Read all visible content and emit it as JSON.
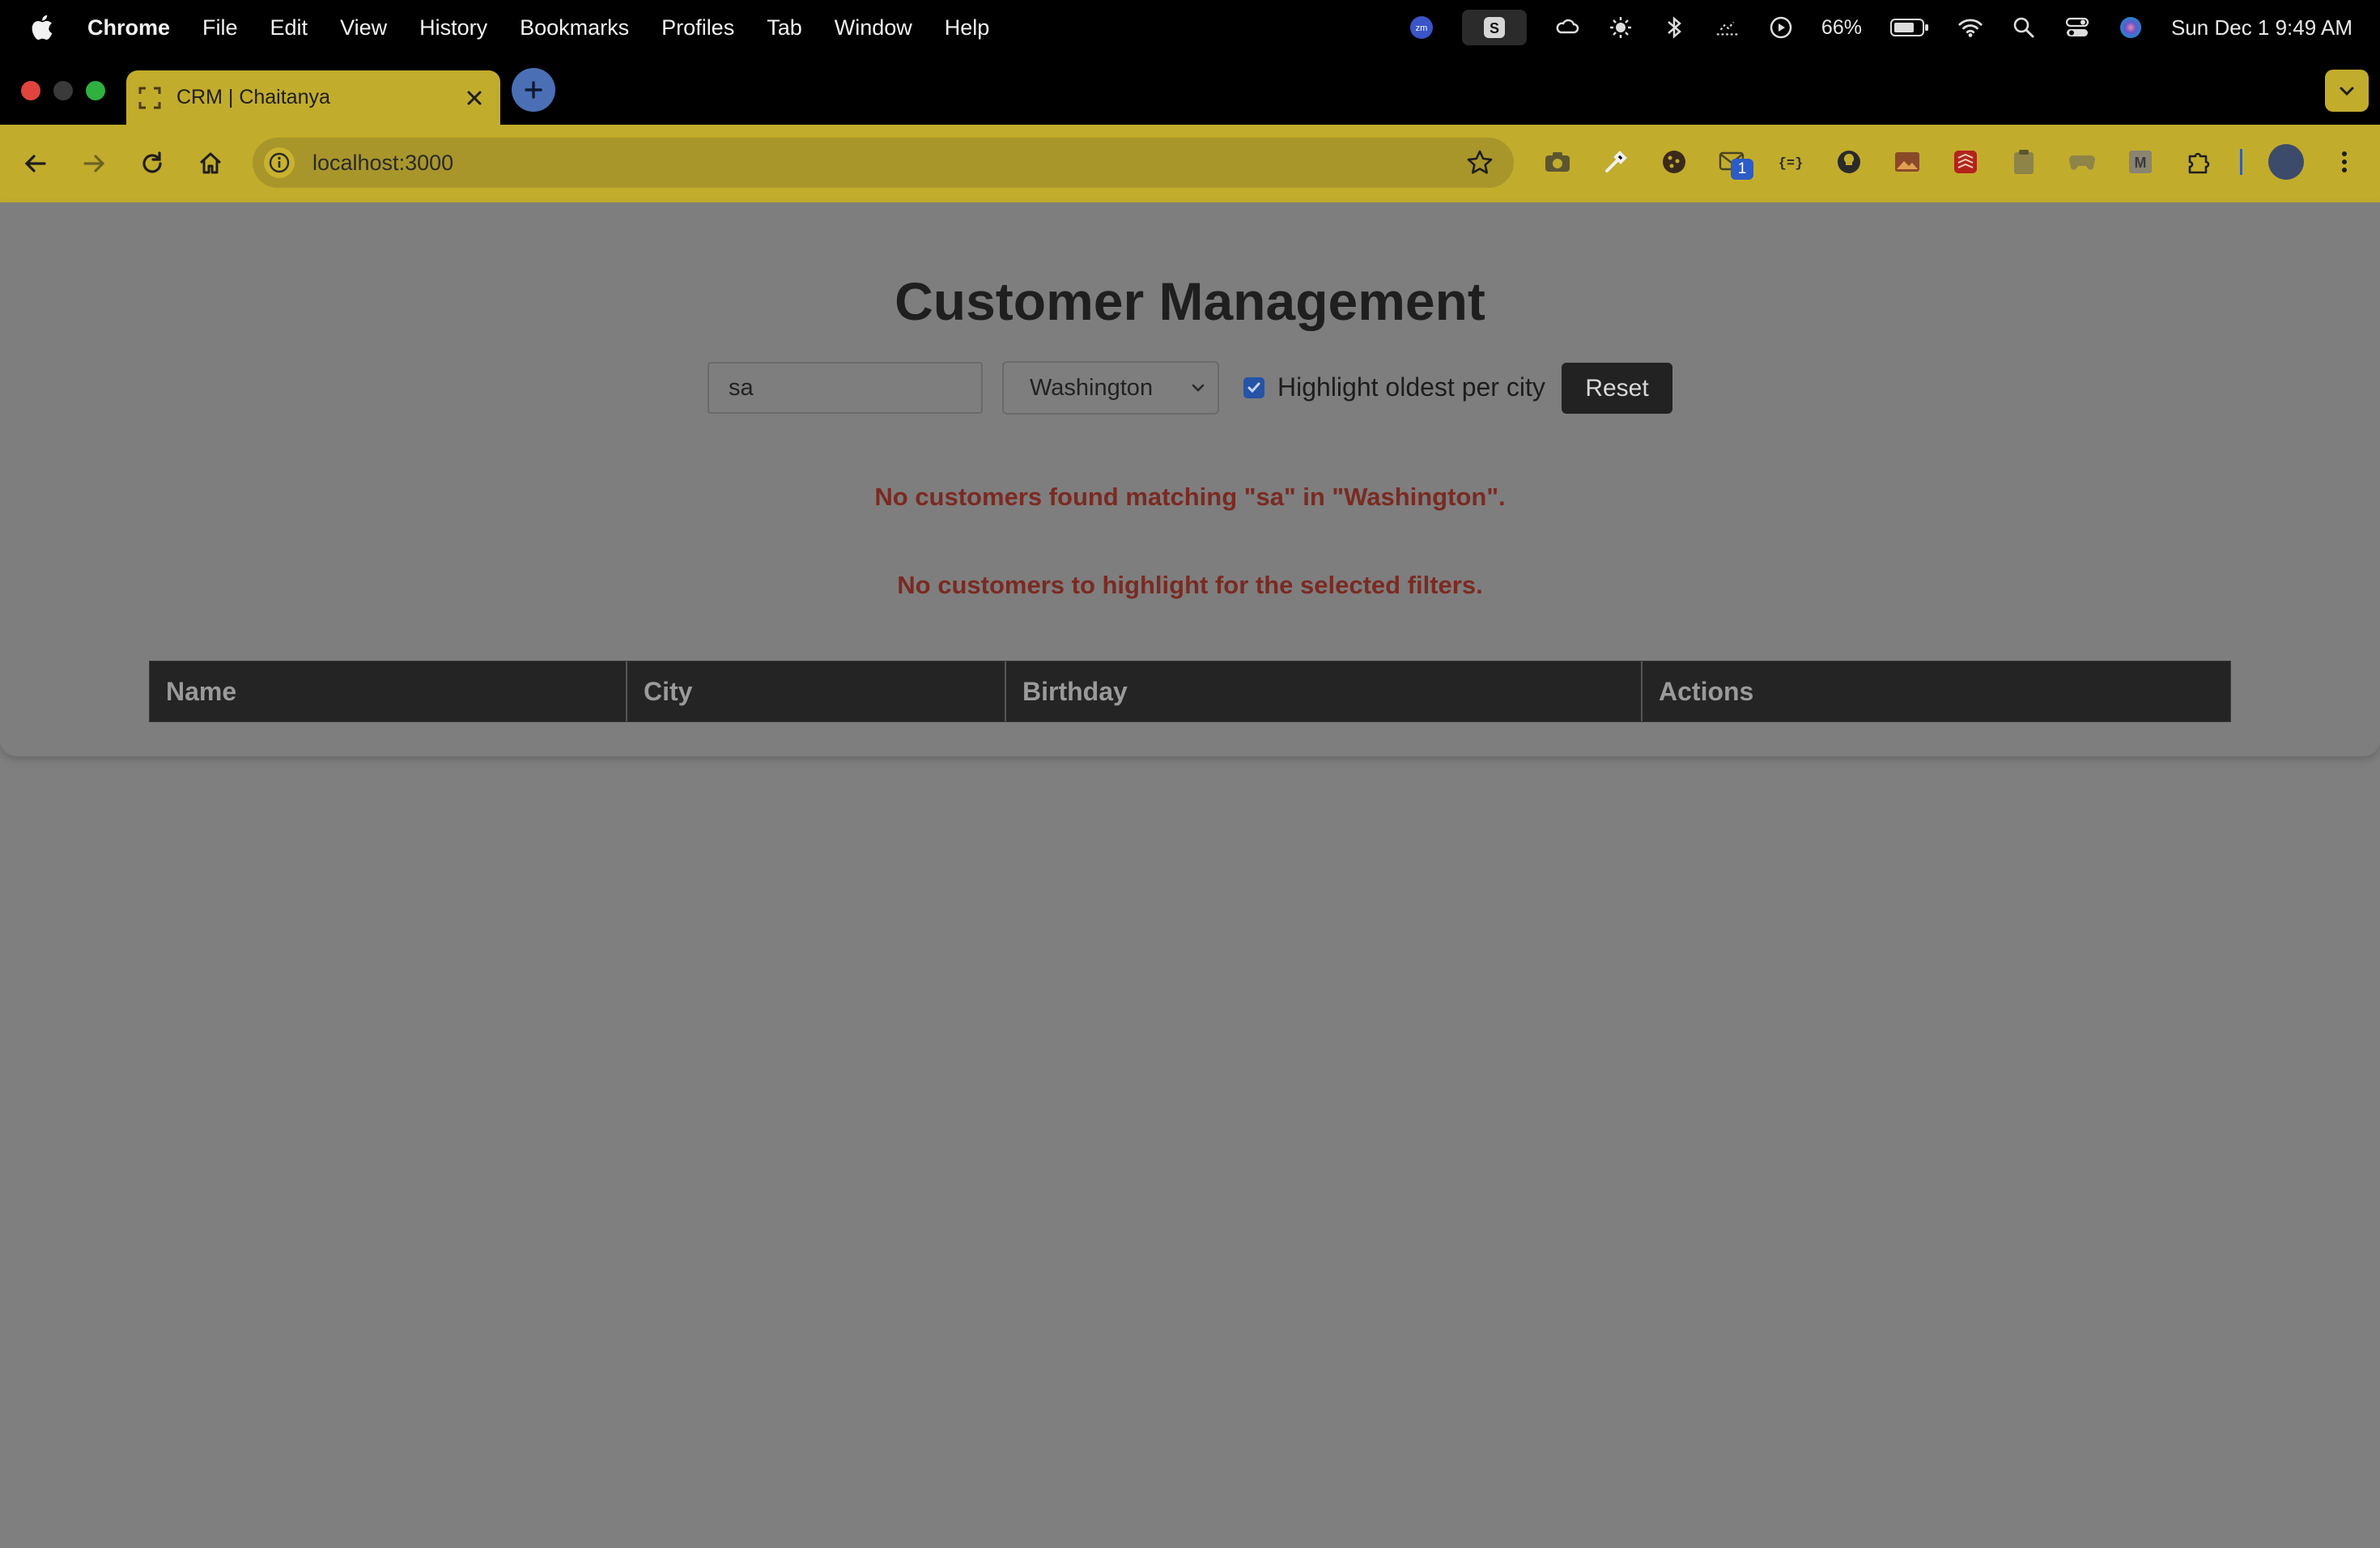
{
  "menubar": {
    "app_name": "Chrome",
    "items": [
      "File",
      "Edit",
      "View",
      "History",
      "Bookmarks",
      "Profiles",
      "Tab",
      "Window",
      "Help"
    ],
    "battery": "66%",
    "clock": "Sun Dec 1  9:49 AM"
  },
  "browser": {
    "tab_title": "CRM | Chaitanya",
    "url": "localhost:3000",
    "extension_badge": "1",
    "colors": {
      "toolbar": "#c2ac2c",
      "accent": "#2c5cc5"
    }
  },
  "page": {
    "title": "Customer Management",
    "search": {
      "value": "sa"
    },
    "city_filter": {
      "selected": "Washington"
    },
    "highlight_checkbox": {
      "label": "Highlight oldest per city",
      "checked": true
    },
    "reset_label": "Reset",
    "messages": {
      "no_match": "No customers found matching \"sa\" in \"Washington\".",
      "no_highlight": "No customers to highlight for the selected filters."
    },
    "table": {
      "columns": [
        "Name",
        "City",
        "Birthday",
        "Actions"
      ],
      "rows": []
    },
    "colors": {
      "error_text": "#7a2a22",
      "header_bg": "#242424"
    }
  }
}
